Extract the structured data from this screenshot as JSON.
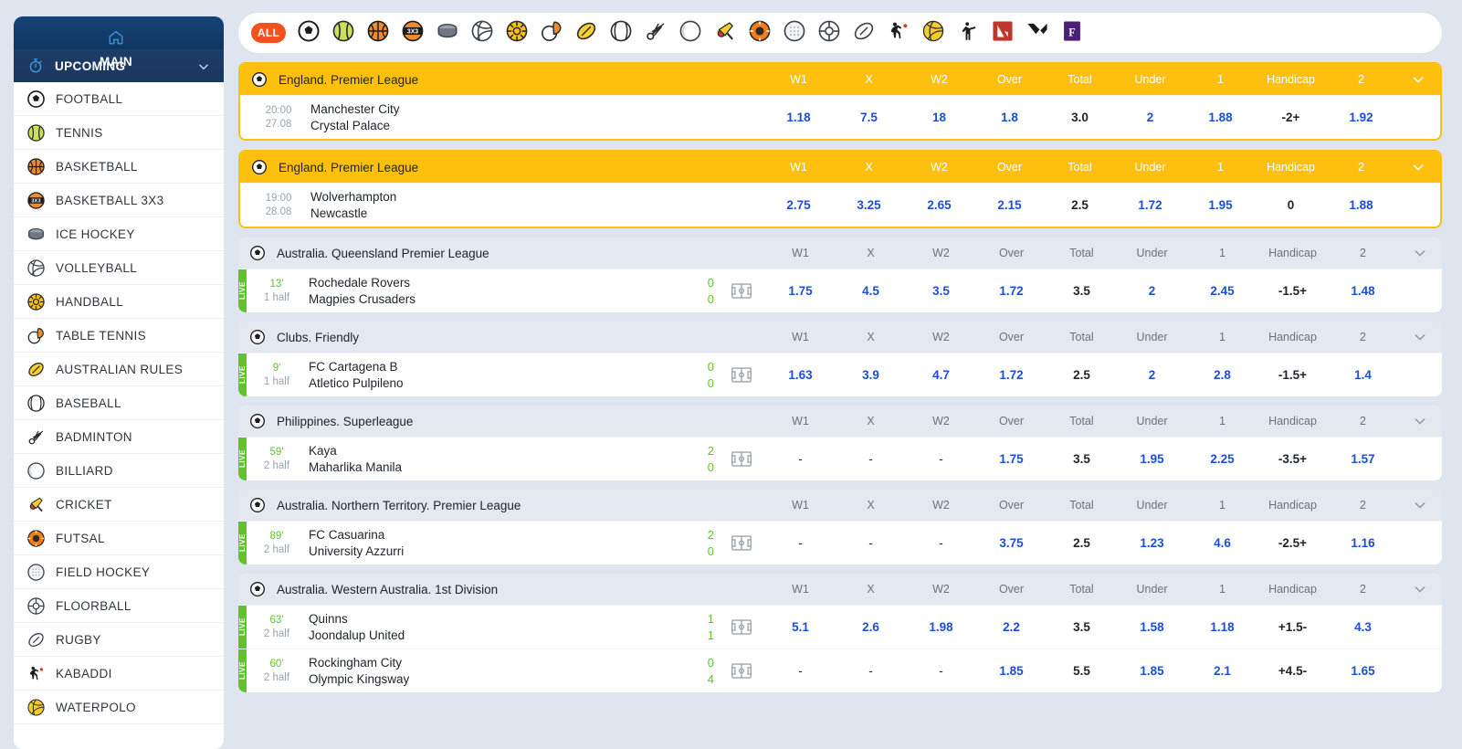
{
  "sidebar": {
    "header_items": [
      {
        "label": "MAIN",
        "icon": "home-icon"
      },
      {
        "label": "UPCOMING",
        "icon": "stopwatch-icon",
        "chevron": "chevron-down-icon"
      }
    ],
    "items": [
      {
        "label": "FOOTBALL",
        "icon": "football-icon"
      },
      {
        "label": "TENNIS",
        "icon": "tennis-icon"
      },
      {
        "label": "BASKETBALL",
        "icon": "basketball-icon"
      },
      {
        "label": "BASKETBALL 3X3",
        "icon": "basketball-3x3-icon"
      },
      {
        "label": "ICE HOCKEY",
        "icon": "ice-hockey-icon"
      },
      {
        "label": "VOLLEYBALL",
        "icon": "volleyball-icon"
      },
      {
        "label": "HANDBALL",
        "icon": "handball-icon"
      },
      {
        "label": "TABLE TENNIS",
        "icon": "table-tennis-icon"
      },
      {
        "label": "AUSTRALIAN RULES",
        "icon": "australian-rules-icon"
      },
      {
        "label": "BASEBALL",
        "icon": "baseball-icon"
      },
      {
        "label": "BADMINTON",
        "icon": "badminton-icon"
      },
      {
        "label": "BILLIARD",
        "icon": "billiard-icon"
      },
      {
        "label": "CRICKET",
        "icon": "cricket-icon"
      },
      {
        "label": "FUTSAL",
        "icon": "futsal-icon"
      },
      {
        "label": "FIELD HOCKEY",
        "icon": "field-hockey-icon"
      },
      {
        "label": "FLOORBALL",
        "icon": "floorball-icon"
      },
      {
        "label": "RUGBY",
        "icon": "rugby-icon"
      },
      {
        "label": "KABADDI",
        "icon": "kabaddi-icon"
      },
      {
        "label": "WATERPOLO",
        "icon": "waterpolo-icon"
      }
    ]
  },
  "sportbar": {
    "all_label": "ALL",
    "icons": [
      "football-icon",
      "tennis-icon",
      "basketball-icon",
      "basketball-3x3-icon",
      "ice-hockey-icon",
      "volleyball-icon",
      "handball-icon",
      "table-tennis-icon",
      "australian-rules-icon",
      "baseball-icon",
      "badminton-icon",
      "billiard-icon",
      "cricket-icon",
      "futsal-icon",
      "field-hockey-icon",
      "floorball-icon",
      "rugby-icon",
      "kabaddi-icon",
      "waterpolo-icon",
      "counter-strike-icon",
      "dota-icon",
      "valorant-icon",
      "fifa-icon"
    ]
  },
  "columns": [
    "W1",
    "X",
    "W2",
    "Over",
    "Total",
    "Under",
    "1",
    "Handicap",
    "2"
  ],
  "leagues": [
    {
      "name": "England. Premier League",
      "featured": true,
      "matches": [
        {
          "live": false,
          "live_label": "",
          "time": "20:00",
          "period": "27.08",
          "home": "Manchester City",
          "away": "Crystal Palace",
          "home_score": "",
          "away_score": "",
          "odds": [
            "1.18",
            "7.5",
            "18",
            "1.8",
            "3.0",
            "2",
            "1.88",
            "-2+",
            "1.92"
          ]
        }
      ]
    },
    {
      "name": "England. Premier League",
      "featured": true,
      "matches": [
        {
          "live": false,
          "live_label": "",
          "time": "19:00",
          "period": "28.08",
          "home": "Wolverhampton",
          "away": "Newcastle",
          "home_score": "",
          "away_score": "",
          "odds": [
            "2.75",
            "3.25",
            "2.65",
            "2.15",
            "2.5",
            "1.72",
            "1.95",
            "0",
            "1.88"
          ]
        }
      ]
    },
    {
      "name": "Australia. Queensland Premier League",
      "featured": false,
      "matches": [
        {
          "live": true,
          "live_label": "LIVE",
          "time": "13'",
          "period": "1 half",
          "home": "Rochedale Rovers",
          "away": "Magpies Crusaders",
          "home_score": "0",
          "away_score": "0",
          "odds": [
            "1.75",
            "4.5",
            "3.5",
            "1.72",
            "3.5",
            "2",
            "2.45",
            "-1.5+",
            "1.48"
          ]
        }
      ]
    },
    {
      "name": "Clubs. Friendly",
      "featured": false,
      "matches": [
        {
          "live": true,
          "live_label": "LIVE",
          "time": "9'",
          "period": "1 half",
          "home": "FC Cartagena B",
          "away": "Atletico Pulpileno",
          "home_score": "0",
          "away_score": "0",
          "odds": [
            "1.63",
            "3.9",
            "4.7",
            "1.72",
            "2.5",
            "2",
            "2.8",
            "-1.5+",
            "1.4"
          ]
        }
      ]
    },
    {
      "name": "Philippines. Superleague",
      "featured": false,
      "matches": [
        {
          "live": true,
          "live_label": "LIVE",
          "time": "59'",
          "period": "2 half",
          "home": "Kaya",
          "away": "Maharlika Manila",
          "home_score": "2",
          "away_score": "0",
          "odds": [
            "-",
            "-",
            "-",
            "1.75",
            "3.5",
            "1.95",
            "2.25",
            "-3.5+",
            "1.57"
          ]
        }
      ]
    },
    {
      "name": "Australia. Northern Territory. Premier League",
      "featured": false,
      "matches": [
        {
          "live": true,
          "live_label": "LIVE",
          "time": "89'",
          "period": "2 half",
          "home": "FC Casuarina",
          "away": "University Azzurri",
          "home_score": "2",
          "away_score": "0",
          "odds": [
            "-",
            "-",
            "-",
            "3.75",
            "2.5",
            "1.23",
            "4.6",
            "-2.5+",
            "1.16"
          ]
        }
      ]
    },
    {
      "name": "Australia. Western Australia. 1st Division",
      "featured": false,
      "matches": [
        {
          "live": true,
          "live_label": "LIVE",
          "time": "63'",
          "period": "2 half",
          "home": "Quinns",
          "away": "Joondalup United",
          "home_score": "1",
          "away_score": "1",
          "odds": [
            "5.1",
            "2.6",
            "1.98",
            "2.2",
            "3.5",
            "1.58",
            "1.18",
            "+1.5-",
            "4.3"
          ]
        },
        {
          "live": true,
          "live_label": "LIVE",
          "time": "60'",
          "period": "2 half",
          "home": "Rockingham City",
          "away": "Olympic Kingsway",
          "home_score": "0",
          "away_score": "4",
          "odds": [
            "-",
            "-",
            "-",
            "1.85",
            "5.5",
            "1.85",
            "2.1",
            "+4.5-",
            "1.65"
          ]
        }
      ]
    }
  ],
  "colors": {
    "featured_yellow": "#fdc00e",
    "sidebar_blue": "#0b2e5c",
    "accent_orange": "#f4511e",
    "odds_blue": "#1b4fd8",
    "live_green": "#5fc32a",
    "page_bg": "#dfe5ef"
  }
}
